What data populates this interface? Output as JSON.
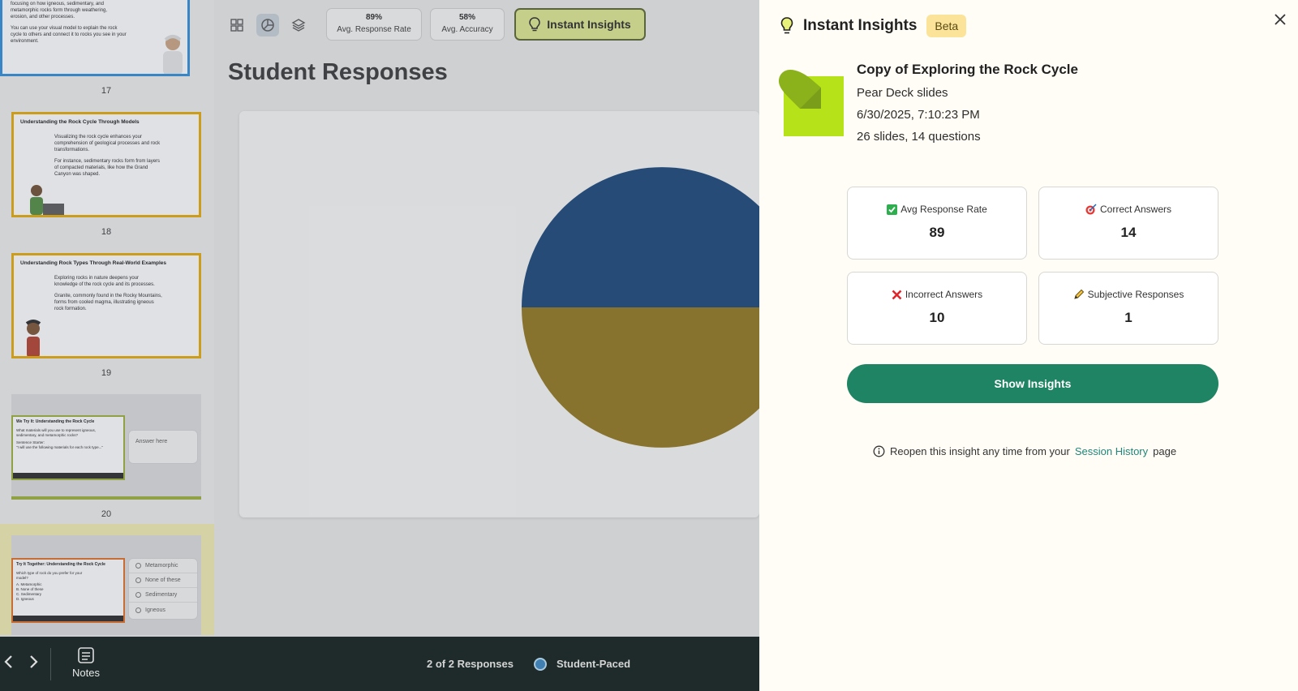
{
  "rail": {
    "slides": [
      {
        "number": "17",
        "texts": [
          "focusing on how igneous, sedimentary, and",
          "metamorphic rocks form through weathering,",
          "erosion, and other processes.",
          "You can use your visual model to explain the rock",
          "cycle to others and connect it to rocks you see in your",
          "environment."
        ]
      },
      {
        "number": "18",
        "title": "Understanding the Rock Cycle Through Models",
        "texts": [
          "Visualizing the rock cycle enhances your",
          "comprehension of geological processes and rock",
          "transformations.",
          "For instance, sedimentary rocks form from layers",
          "of compacted materials, like how the Grand",
          "Canyon was shaped."
        ]
      },
      {
        "number": "19",
        "title": "Understanding Rock Types Through Real-World Examples",
        "texts": [
          "Exploring rocks in nature deepens your",
          "knowledge of the rock cycle and its processes.",
          "Granite, commonly found in the Rocky Mountains,",
          "forms from cooled magma, illustrating igneous",
          "rock formation."
        ]
      },
      {
        "number": "20",
        "title": "We Try It: Understanding the Rock Cycle",
        "texts": [
          "What materials will you use to represent igneous,",
          "sedimentary, and metamorphic rocks?",
          "Sentence Starter:",
          "\"I will use the following materials for each rock type...\""
        ],
        "side": "Answer here"
      },
      {
        "number": "21",
        "title": "Try It Together: Understanding the Rock Cycle",
        "texts": [
          "Which type of rock do you prefer for your",
          "model?",
          "A. Metamorphic",
          "B. None of these",
          "C. Sedimentary",
          "D. Igneous"
        ],
        "options": [
          "Metamorphic",
          "None of these",
          "Sedimentary",
          "Igneous"
        ]
      }
    ]
  },
  "topbar": {
    "avg_response_value": "89%",
    "avg_response_label": "Avg. Response Rate",
    "avg_accuracy_value": "58%",
    "avg_accuracy_label": "Avg. Accuracy",
    "instant_insights_label": "Instant Insights"
  },
  "main": {
    "title": "Student Responses"
  },
  "chart_data": {
    "type": "pie",
    "colors": [
      "#123f74",
      "#8f7117"
    ],
    "values": [
      50,
      50
    ]
  },
  "bottombar": {
    "notes_label": "Notes",
    "responses": "2 of 2 Responses",
    "mode": "Student-Paced"
  },
  "panel": {
    "title": "Instant Insights",
    "badge": "Beta",
    "deck_name": "Copy of Exploring the Rock Cycle",
    "source": "Pear Deck slides",
    "date": "6/30/2025, 7:10:23 PM",
    "counts": "26 slides, 14 questions",
    "cards": [
      {
        "icon": "check-mark-icon",
        "label": "Avg Response Rate",
        "value": "89"
      },
      {
        "icon": "target-icon",
        "label": "Correct Answers",
        "value": "14"
      },
      {
        "icon": "cross-mark-icon",
        "label": "Incorrect Answers",
        "value": "10"
      },
      {
        "icon": "pencil-icon",
        "label": "Subjective Responses",
        "value": "1"
      }
    ],
    "show_button": "Show Insights",
    "reopen_prefix": "Reopen this insight any time from your",
    "reopen_link": "Session History",
    "reopen_suffix": "page"
  },
  "colors": {
    "accent": "#1f8463",
    "lime": "#b6e21a",
    "beta": "#fbe39a"
  }
}
